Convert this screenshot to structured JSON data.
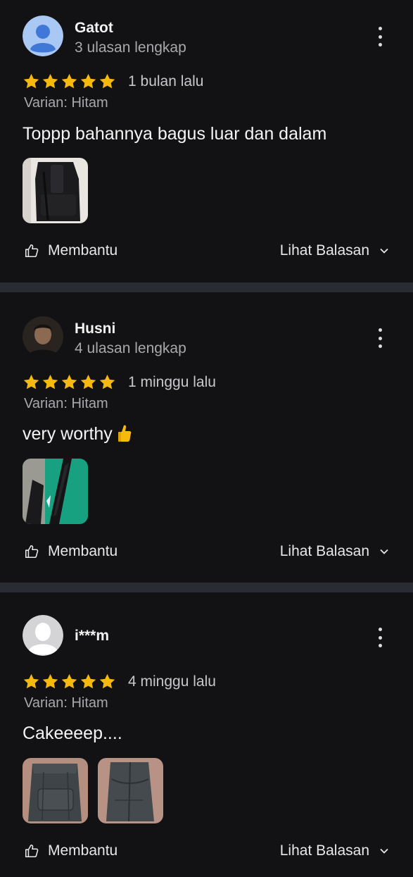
{
  "colors": {
    "star": "#f6b90e",
    "background": "#121214",
    "divider": "#2a2c33",
    "muted": "#a9a9ad"
  },
  "icons": {
    "star": "star-icon",
    "more": "more-vert-icon",
    "helpful": "thumbs-up-outline-icon",
    "chevron": "chevron-down-icon",
    "emoji": "thumbs-up-emoji"
  },
  "reviews": [
    {
      "name": "Gatot",
      "subtitle": "3 ulasan lengkap",
      "rating": 5,
      "time": "1 bulan lalu",
      "variant": "Varian: Hitam",
      "text": "Toppp bahannya bagus luar dan dalam",
      "helpful_label": "Membantu",
      "replies_label": "Lihat Balasan"
    },
    {
      "name": "Husni",
      "subtitle": "4 ulasan lengkap",
      "rating": 5,
      "time": "1 minggu lalu",
      "variant": "Varian: Hitam",
      "text": "very worthy",
      "helpful_label": "Membantu",
      "replies_label": "Lihat Balasan"
    },
    {
      "name": "i***m",
      "rating": 5,
      "time": "4 minggu lalu",
      "variant": "Varian: Hitam",
      "text": "Cakeeeep....",
      "helpful_label": "Membantu",
      "replies_label": "Lihat Balasan"
    }
  ]
}
